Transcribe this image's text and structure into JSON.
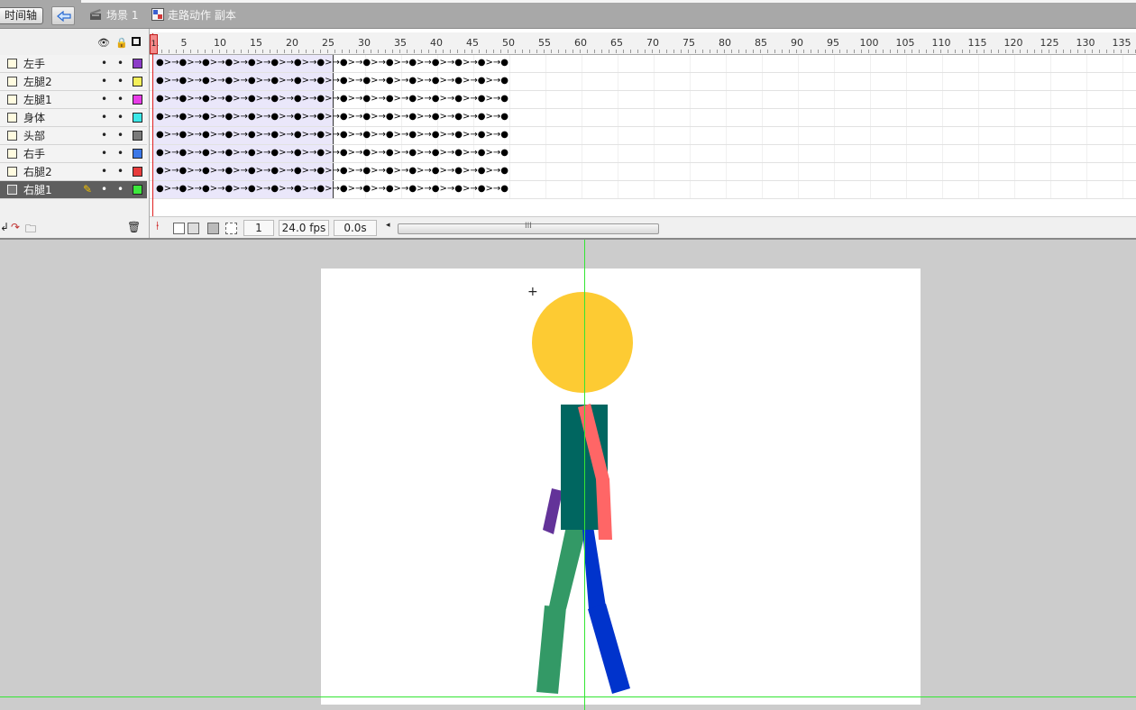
{
  "toolbar": {
    "timeline_label": "时间轴",
    "back_icon": "back-arrow-icon",
    "scene_label": "场景 1",
    "symbol_label": "走路动作 副本"
  },
  "layers": [
    {
      "name": "左手",
      "color": "#8c3cc8",
      "selected": false
    },
    {
      "name": "左腿2",
      "color": "#f4f05a",
      "selected": false
    },
    {
      "name": "左腿1",
      "color": "#e83ce8",
      "selected": false
    },
    {
      "name": "身体",
      "color": "#3ce8e8",
      "selected": false
    },
    {
      "name": "头部",
      "color": "#7a7a7a",
      "selected": false
    },
    {
      "name": "右手",
      "color": "#3c78e8",
      "selected": false
    },
    {
      "name": "右腿2",
      "color": "#e83c3c",
      "selected": false
    },
    {
      "name": "右腿1",
      "color": "#3ce83c",
      "selected": true
    }
  ],
  "ruler_labels": [
    "1",
    "5",
    "10",
    "15",
    "20",
    "25",
    "30",
    "35",
    "40",
    "45",
    "50",
    "55",
    "60",
    "65",
    "70",
    "75",
    "80",
    "85",
    "90",
    "95",
    "100",
    "105",
    "110",
    "115",
    "120",
    "125",
    "130",
    "135"
  ],
  "tween_pattern": "●>→●>→●>→●>→●>→●>→●>→●>→●>→●>→●>→●>→●>→●>→●>→●",
  "status": {
    "current_frame": "1",
    "fps": "24.0 fps",
    "elapsed": "0.0s",
    "scroll_grip": "III"
  },
  "stage": {
    "background": "#ffffff",
    "head_color": "#fdcb33",
    "body_color": "#006660",
    "left_arm_color": "#633399",
    "right_arm_color": "#ff6666",
    "left_leg_color": "#339966",
    "right_leg_color": "#0033cc",
    "guide_color": "#33e633"
  }
}
